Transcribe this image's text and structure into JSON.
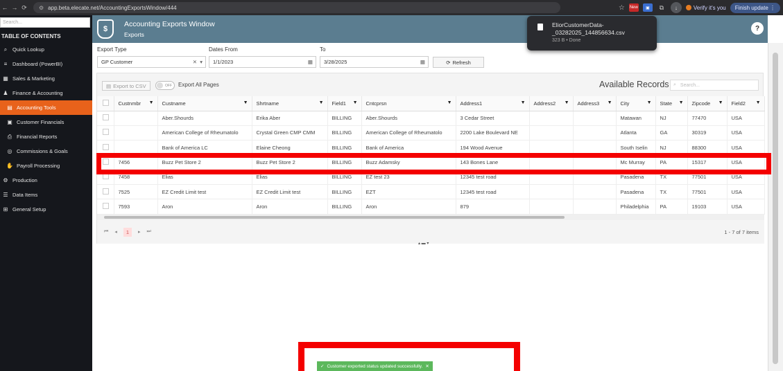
{
  "browser": {
    "url": "app.beta.elecate.net/AccountingExportsWindow/444",
    "news_badge": "New",
    "verify_label": "Verify it's you",
    "finish_update": "Finish update"
  },
  "download_popup": {
    "filename": "EliorCustomerData-_03282025_144856634.csv",
    "status": "323 B • Done"
  },
  "sidebar": {
    "search_placeholder": "Search...",
    "title": "TABLE OF CONTENTS",
    "items": [
      {
        "label": "Quick Lookup",
        "icon": "search-icon"
      },
      {
        "label": "Dashboard (PowerBI)",
        "icon": "menu-icon"
      },
      {
        "label": "Sales & Marketing",
        "icon": "table-icon"
      },
      {
        "label": "Finance & Accounting",
        "icon": "people-icon"
      },
      {
        "label": "Accounting Tools",
        "icon": "document-icon",
        "active": true
      },
      {
        "label": "Customer Financials",
        "icon": "document-icon"
      },
      {
        "label": "Financial Reports",
        "icon": "printer-icon"
      },
      {
        "label": "Commissions & Goals",
        "icon": "target-icon"
      },
      {
        "label": "Payroll Processing",
        "icon": "hand-money-icon"
      },
      {
        "label": "Production",
        "icon": "gear-icon"
      },
      {
        "label": "Data Items",
        "icon": "list-icon"
      },
      {
        "label": "General Setup",
        "icon": "briefcase-icon"
      }
    ]
  },
  "header": {
    "title": "Accounting Exports Window",
    "subtitle": "Exports",
    "logo_symbol": "$"
  },
  "filters": {
    "export_type_label": "Export Type",
    "export_type_value": "GP Customer",
    "dates_from_label": "Dates From",
    "dates_from_value": "1/1/2023",
    "to_label": "To",
    "to_value": "3/28/2025",
    "refresh_label": "Refresh"
  },
  "grid": {
    "export_csv_label": "Export to CSV",
    "toggle_label": "OFF",
    "export_all_label": "Export All Pages",
    "available_records_label": "Available Records",
    "search_placeholder": "Search...",
    "columns": [
      "Custnmbr",
      "Custname",
      "Shrtname",
      "Field1",
      "Cntcprsn",
      "Address1",
      "Address2",
      "Address3",
      "City",
      "State",
      "Zipcode",
      "Field2"
    ],
    "rows": [
      [
        "",
        "Aber.Shourds",
        "Erika Aber",
        "BILLING",
        "Aber.Shourds",
        "3 Cedar Street",
        "",
        "",
        "Matawan",
        "NJ",
        "77470",
        "USA"
      ],
      [
        "",
        "American College of Rheumatolo",
        "Crystal Green CMP CMM",
        "BILLING",
        "American College of Rheumatolo",
        "2200 Lake Boulevard NE",
        "",
        "",
        "Atlanta",
        "GA",
        "30319",
        "USA"
      ],
      [
        "",
        "Bank of America LC",
        "Elaine Cheong",
        "BILLING",
        "Bank of America",
        "194 Wood Avenue",
        "",
        "",
        "South Iselin",
        "NJ",
        "88300",
        "USA"
      ],
      [
        "7456",
        "Buzz Pet Store 2",
        "Buzz Pet Store 2",
        "BILLING",
        "Buzz Adamsky",
        "143 Bones Lane",
        "",
        "",
        "Mc Murray",
        "PA",
        "15317",
        "USA"
      ],
      [
        "7458",
        "Elias",
        "Elias",
        "BILLING",
        "EZ test 23",
        "12345 test road",
        "",
        "",
        "Pasadena",
        "TX",
        "77501",
        "USA"
      ],
      [
        "7525",
        "EZ Credit Limit test",
        "EZ Credit Limit test",
        "BILLING",
        "EZT",
        "12345 test road",
        "",
        "",
        "Pasadena",
        "TX",
        "77501",
        "USA"
      ],
      [
        "7593",
        "Aron",
        "Aron",
        "BILLING",
        "Aron",
        "879",
        "",
        "",
        "Philadelphia",
        "PA",
        "19103",
        "USA"
      ]
    ],
    "page": "1",
    "items_count": "1 - 7 of 7 items"
  },
  "toast": {
    "message": "Customer exported status updated successfully."
  }
}
